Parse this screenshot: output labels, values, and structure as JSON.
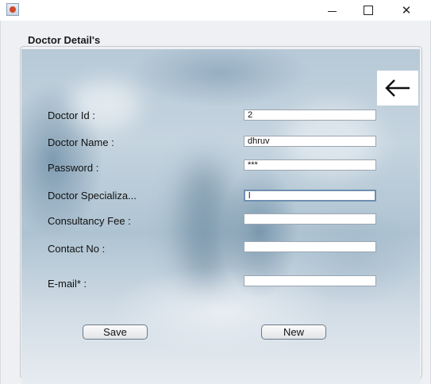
{
  "window": {
    "icon": "java-app-icon",
    "controls": {
      "minimize": "minimize-icon",
      "maximize": "maximize-icon",
      "close_glyph": "✕"
    }
  },
  "panel": {
    "title": "Doctor Detail's",
    "back_icon": "arrow-left-icon"
  },
  "form": {
    "fields": [
      {
        "label": "Doctor Id :",
        "value": "2"
      },
      {
        "label": "Doctor Name :",
        "value": "dhruv"
      },
      {
        "label": "Password :",
        "value": "***"
      },
      {
        "label": "Doctor Specializa...",
        "value": "l"
      },
      {
        "label": "Consultancy Fee :",
        "value": ""
      },
      {
        "label": "Contact No :",
        "value": ""
      },
      {
        "label": "E-mail* :",
        "value": ""
      }
    ]
  },
  "buttons": {
    "save": "Save",
    "new": "New"
  }
}
